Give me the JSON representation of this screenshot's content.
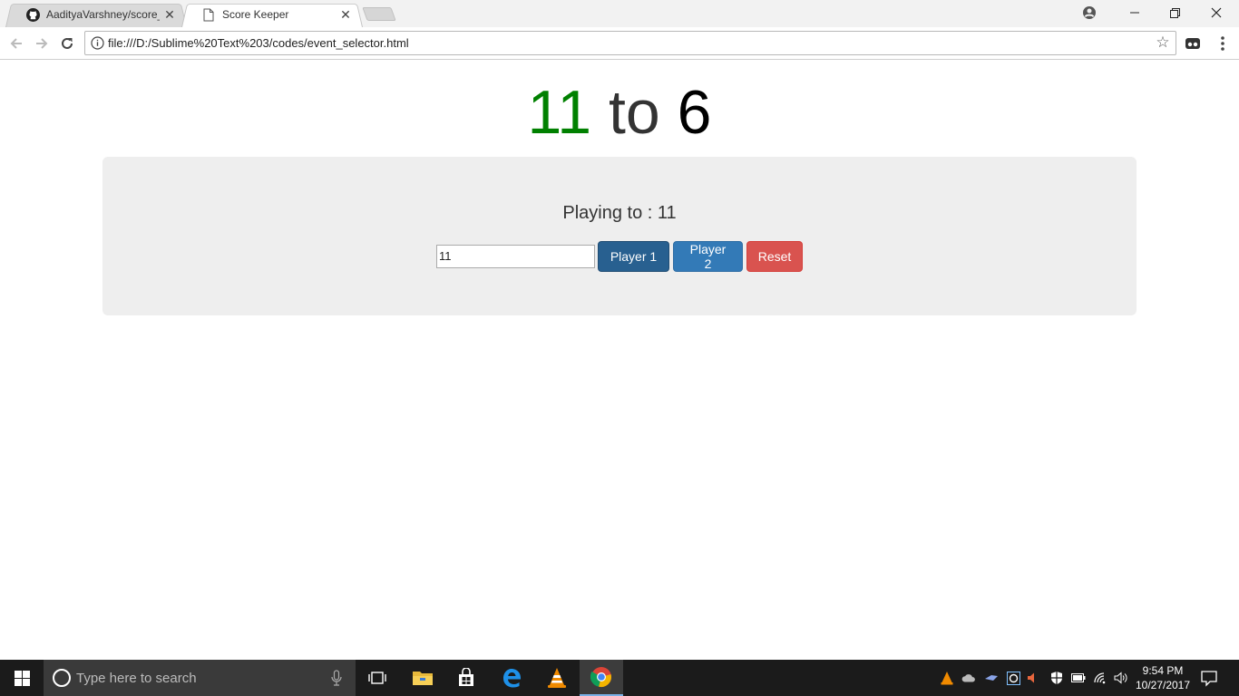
{
  "browser": {
    "tabs": [
      {
        "title": "AadityaVarshney/score_k",
        "icon": "github-icon",
        "active": false
      },
      {
        "title": "Score Keeper",
        "icon": "page-icon",
        "active": true
      }
    ],
    "address": "file:///D:/Sublime%20Text%203/codes/event_selector.html"
  },
  "page": {
    "score": {
      "player1": "11",
      "separator": " to ",
      "player2": "6"
    },
    "playing_to": "Playing to : 11",
    "input": {
      "value": "11"
    },
    "buttons": {
      "player1": "Player 1",
      "player2": "Player 2",
      "reset": "Reset"
    }
  },
  "colors": {
    "player1_score": "#008000",
    "btn_primary": "#337ab7",
    "btn_danger": "#d9534f",
    "panel": "#eeeeee"
  },
  "taskbar": {
    "search_placeholder": "Type here to search",
    "pinned": [
      "task-view-icon",
      "file-explorer-icon",
      "store-icon",
      "edge-icon",
      "vlc-icon",
      "chrome-icon"
    ],
    "time": "9:54 PM",
    "date": "10/27/2017"
  }
}
